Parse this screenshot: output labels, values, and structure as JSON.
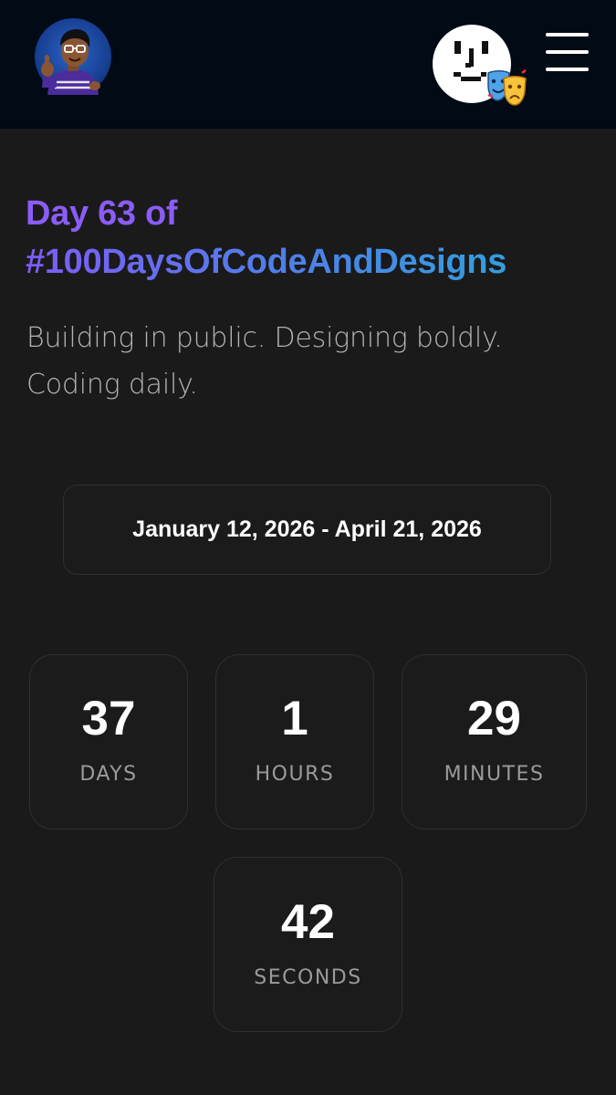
{
  "header": {
    "logo_icon": "developer-avatar-logo",
    "face_icon": "pixel-face-icon",
    "masks_icon": "theater-masks-icon",
    "menu_icon": "hamburger-menu-icon"
  },
  "hero": {
    "title_line1": "Day 63 of",
    "title_line2": "#100DaysOfCodeAndDesigns",
    "tagline_line1": "Building in public. Designing boldly.",
    "tagline_line2": "Coding daily.",
    "colors": {
      "title_purple": "#8b5cf6",
      "title_gradient_start": "#7e5cf5",
      "title_gradient_end": "#28acd8"
    }
  },
  "date_range": "January 12, 2026 - April 21, 2026",
  "countdown": {
    "days": {
      "value": "37",
      "label": "DAYS"
    },
    "hours": {
      "value": "1",
      "label": "HOURS"
    },
    "minutes": {
      "value": "29",
      "label": "MINUTES"
    },
    "seconds": {
      "value": "42",
      "label": "SECONDS"
    }
  }
}
